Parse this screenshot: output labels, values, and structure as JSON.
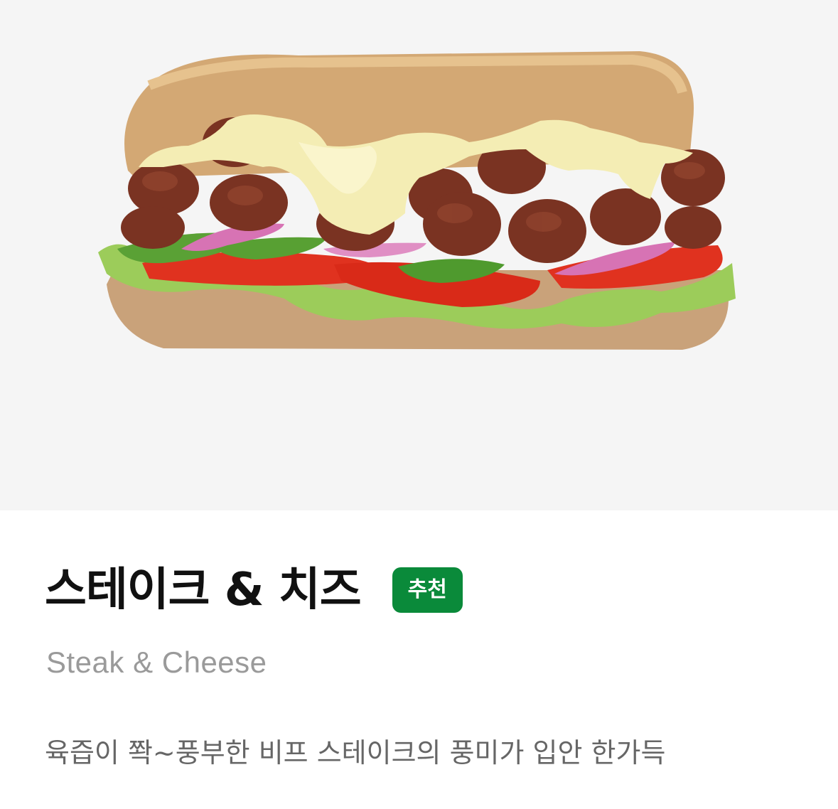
{
  "hero": {
    "image": "steak-and-cheese-sandwich-photo",
    "background": "#f5f5f5"
  },
  "product": {
    "name_ko": "스테이크 & 치즈",
    "name_en": "Steak & Cheese",
    "badge": "추천",
    "description": "육즙이 쫙~풍부한 비프 스테이크의 풍미가 입안 한가득"
  },
  "colors": {
    "badge_bg": "#0a8a3a",
    "title": "#111111",
    "subtitle": "#9a9a9a",
    "description": "#666666"
  }
}
